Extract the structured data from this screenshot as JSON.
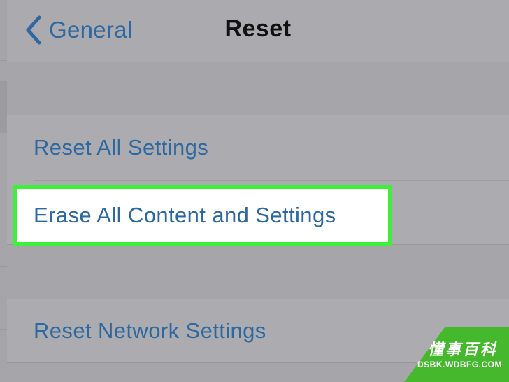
{
  "nav": {
    "back_label": "General",
    "title": "Reset"
  },
  "cells": {
    "reset_all": "Reset All Settings",
    "erase_all": "Erase All Content and Settings",
    "reset_network": "Reset Network Settings"
  },
  "watermark": {
    "cn": "懂事百科",
    "en": "DSBK.WDBFG.COM"
  },
  "colors": {
    "accent": "#2d68a0",
    "highlight_border": "#3ef03a",
    "watermark": "#46b82e"
  }
}
